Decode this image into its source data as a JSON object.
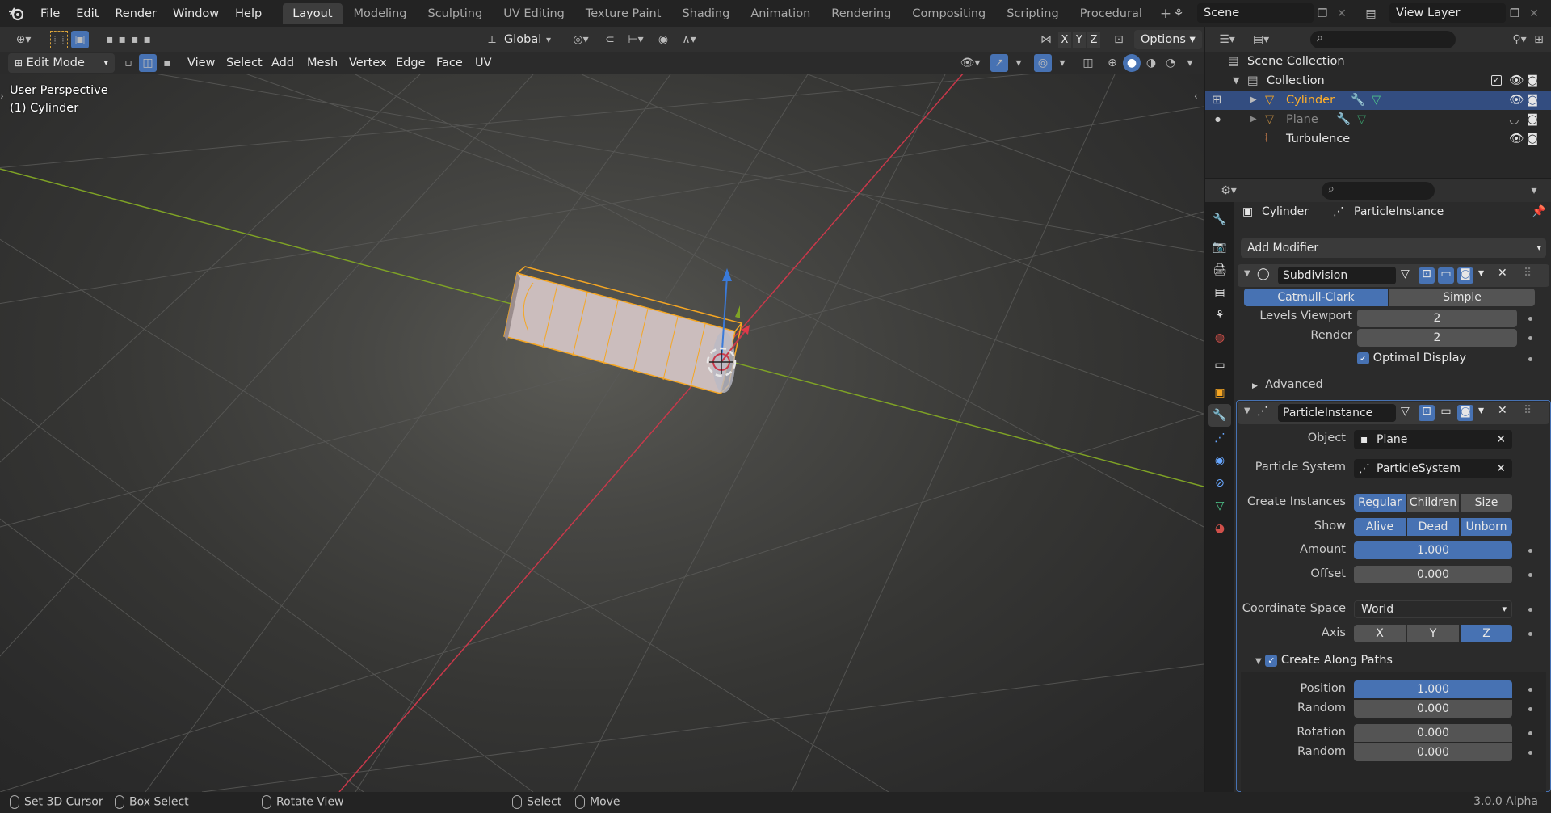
{
  "menu": [
    "File",
    "Edit",
    "Render",
    "Window",
    "Help"
  ],
  "workspaces": [
    "Layout",
    "Modeling",
    "Sculpting",
    "UV Editing",
    "Texture Paint",
    "Shading",
    "Animation",
    "Rendering",
    "Compositing",
    "Scripting",
    "Procedural"
  ],
  "scene_name": "Scene",
  "view_layer": "View Layer",
  "toolbar": {
    "orientation": "Global",
    "options": "Options",
    "axis_x": "X",
    "axis_y": "Y",
    "axis_z": "Z"
  },
  "viewport_header": {
    "mode": "Edit Mode",
    "menus": [
      "View",
      "Select",
      "Add",
      "Mesh",
      "Vertex",
      "Edge",
      "Face",
      "UV"
    ]
  },
  "viewport": {
    "perspective": "User Perspective",
    "object": "(1) Cylinder"
  },
  "outliner": {
    "root": "Scene Collection",
    "collection": "Collection",
    "items": [
      "Cylinder",
      "Plane",
      "Turbulence"
    ]
  },
  "props": {
    "object": "Cylinder",
    "modifier_crumb": "ParticleInstance",
    "add_modifier": "Add Modifier",
    "subdivision": {
      "name": "Subdivision",
      "mode_a": "Catmull-Clark",
      "mode_b": "Simple",
      "levels_label": "Levels Viewport",
      "levels": "2",
      "render_label": "Render",
      "render": "2",
      "optimal": "Optimal Display",
      "advanced": "Advanced"
    },
    "particle": {
      "name": "ParticleInstance",
      "object_label": "Object",
      "object": "Plane",
      "psys_label": "Particle System",
      "psys": "ParticleSystem",
      "create_label": "Create Instances",
      "create": [
        "Regular",
        "Children",
        "Size"
      ],
      "show_label": "Show",
      "show": [
        "Alive",
        "Dead",
        "Unborn"
      ],
      "amount_label": "Amount",
      "amount": "1.000",
      "offset_label": "Offset",
      "offset": "0.000",
      "coord_label": "Coordinate Space",
      "coord": "World",
      "axis_label": "Axis",
      "axis": [
        "X",
        "Y",
        "Z"
      ],
      "paths": "Create Along Paths",
      "position_label": "Position",
      "position": "1.000",
      "random1_label": "Random",
      "random1": "0.000",
      "rotation_label": "Rotation",
      "rotation": "0.000",
      "random2_label": "Random",
      "random2": "0.000"
    }
  },
  "status": {
    "cursor": "Set 3D Cursor",
    "box": "Box Select",
    "rotate": "Rotate View",
    "select": "Select",
    "move": "Move",
    "version": "3.0.0 Alpha"
  },
  "colors": {
    "accent": "#4772b3",
    "selected": "#f5a623",
    "x_axis": "#c8384a",
    "y_axis": "#7fa325"
  }
}
